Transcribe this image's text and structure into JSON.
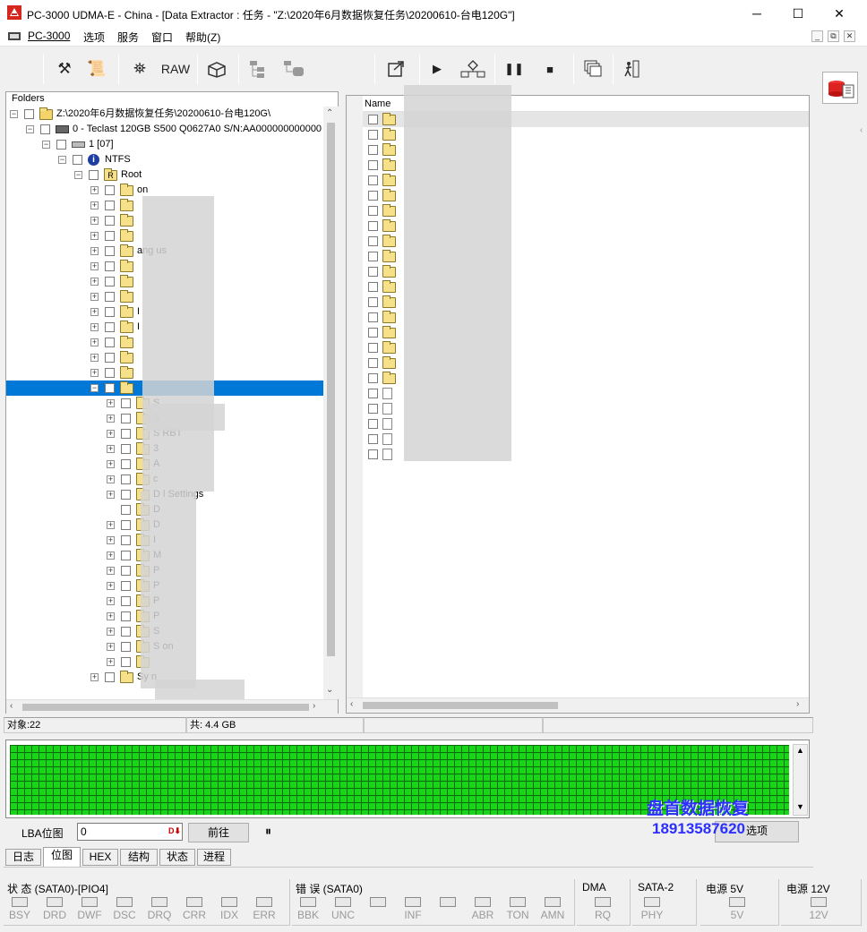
{
  "window": {
    "title": "PC-3000 UDMA-E - China - [Data Extractor : 任务 - \"Z:\\2020年6月数据恢复任务\\20200610-台电120G\"]",
    "minimize": "─",
    "maximize": "☐",
    "close": "✕"
  },
  "menu": {
    "items": [
      "PC-3000",
      "选项",
      "服务",
      "窗口",
      "帮助(Z)"
    ]
  },
  "mdi": {
    "minimize": "_",
    "restore": "⧉",
    "close": "✕"
  },
  "toolbar": {
    "raw_label": "RAW",
    "buttons": [
      "tools-icon",
      "scroll-icon",
      "binoculars-icon",
      "raw-button",
      "box-icon",
      "tree-icon",
      "tree2-icon",
      "export-icon",
      "play-icon",
      "network-icon",
      "pause-icon",
      "stop-icon",
      "windows-icon",
      "exit-icon"
    ]
  },
  "tree": {
    "header": "Folders",
    "rows": [
      {
        "label": "Z:\\2020年6月数据恢复任务\\20200610-台电120G\\",
        "level": 0,
        "kind": "task"
      },
      {
        "label": "0 - Teclast 120GB S500 Q0627A0 S/N:AA000000000000",
        "level": 1,
        "kind": "disk"
      },
      {
        "label": "1 [07]",
        "level": 2,
        "kind": "partition"
      },
      {
        "label": "NTFS",
        "level": 3,
        "kind": "fs"
      },
      {
        "label": "Root",
        "level": 4,
        "kind": "root"
      },
      {
        "label": "on",
        "level": 5,
        "kind": "folder"
      },
      {
        "label": "",
        "level": 5,
        "kind": "folder"
      },
      {
        "label": "",
        "level": 5,
        "kind": "folder"
      },
      {
        "label": "",
        "level": 5,
        "kind": "folder"
      },
      {
        "label": "ang    us",
        "level": 5,
        "kind": "folder"
      },
      {
        "label": "",
        "level": 5,
        "kind": "folder"
      },
      {
        "label": "",
        "level": 5,
        "kind": "folder"
      },
      {
        "label": "",
        "level": 5,
        "kind": "folder"
      },
      {
        "label": "I",
        "level": 5,
        "kind": "folder"
      },
      {
        "label": "I",
        "level": 5,
        "kind": "folder"
      },
      {
        "label": "",
        "level": 5,
        "kind": "folder"
      },
      {
        "label": "",
        "level": 5,
        "kind": "folder"
      },
      {
        "label": "",
        "level": 5,
        "kind": "folder"
      },
      {
        "label": "",
        "level": 5,
        "kind": "folder",
        "selected": true
      },
      {
        "label": "S",
        "level": 6,
        "kind": "folder"
      },
      {
        "label": "S",
        "level": 6,
        "kind": "folder"
      },
      {
        "label": "S         RBT",
        "level": 6,
        "kind": "folder"
      },
      {
        "label": "3",
        "level": 6,
        "kind": "folder"
      },
      {
        "label": "A",
        "level": 6,
        "kind": "folder"
      },
      {
        "label": "c",
        "level": 6,
        "kind": "folder"
      },
      {
        "label": "D          l Settings",
        "level": 6,
        "kind": "folder"
      },
      {
        "label": "D",
        "level": 6,
        "kind": "folder"
      },
      {
        "label": "D",
        "level": 6,
        "kind": "folder"
      },
      {
        "label": "I",
        "level": 6,
        "kind": "folder"
      },
      {
        "label": "M",
        "level": 6,
        "kind": "folder"
      },
      {
        "label": "P",
        "level": 6,
        "kind": "folder"
      },
      {
        "label": "P",
        "level": 6,
        "kind": "folder"
      },
      {
        "label": "P",
        "level": 6,
        "kind": "folder"
      },
      {
        "label": "P",
        "level": 6,
        "kind": "folder"
      },
      {
        "label": "S",
        "level": 6,
        "kind": "folder"
      },
      {
        "label": "S             on",
        "level": 6,
        "kind": "folder"
      },
      {
        "label": "",
        "level": 6,
        "kind": "folder"
      },
      {
        "label": "Sy      n",
        "level": 5,
        "kind": "folder"
      }
    ]
  },
  "list": {
    "column_name": "Name",
    "rows": 23
  },
  "status": {
    "objects": "对象:22",
    "total": "共: 4.4 GB"
  },
  "lba": {
    "label": "LBA位图",
    "value": "0",
    "go_button": "前往",
    "pause_icon": "⏸",
    "right_button": "选项"
  },
  "tabs": [
    "日志",
    "位图",
    "HEX",
    "结构",
    "状态",
    "进程"
  ],
  "active_tab": 1,
  "watermark": {
    "line1": "盘首数据恢复",
    "line2": "18913587620"
  },
  "bottom": {
    "status_title": "状 态 (SATA0)-[PIO4]",
    "status_leds": [
      "BSY",
      "DRD",
      "DWF",
      "DSC",
      "DRQ",
      "CRR",
      "IDX",
      "ERR"
    ],
    "error_title": "错 误 (SATA0)",
    "error_leds": [
      "BBK",
      "UNC",
      "",
      "INF",
      "",
      "ABR",
      "TON",
      "AMN"
    ],
    "dma_title": "DMA",
    "dma_leds": [
      "RQ"
    ],
    "sata_title": "SATA-2",
    "sata_leds": [
      "PHY"
    ],
    "p5_title": "电源 5V",
    "p5_leds": [
      "5V"
    ],
    "p12_title": "电源 12V",
    "p12_leds": [
      "12V"
    ]
  }
}
